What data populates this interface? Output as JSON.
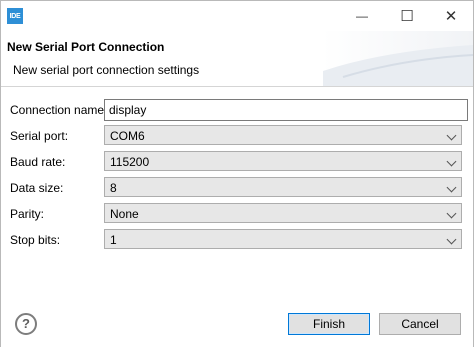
{
  "window": {
    "app_icon_text": "IDE",
    "minimize_glyph": "—",
    "maximize_glyph": "☐",
    "close_glyph": "✕"
  },
  "header": {
    "title": "New Serial Port Connection",
    "description": "New serial port connection settings"
  },
  "form": {
    "connection_name": {
      "label": "Connection name:",
      "value": "display"
    },
    "serial_port": {
      "label": "Serial port:",
      "value": "COM6"
    },
    "baud_rate": {
      "label": "Baud rate:",
      "value": "115200"
    },
    "data_size": {
      "label": "Data size:",
      "value": "8"
    },
    "parity": {
      "label": "Parity:",
      "value": "None"
    },
    "stop_bits": {
      "label": "Stop bits:",
      "value": "1"
    }
  },
  "footer": {
    "help_glyph": "?",
    "finish_label": "Finish",
    "cancel_label": "Cancel"
  }
}
